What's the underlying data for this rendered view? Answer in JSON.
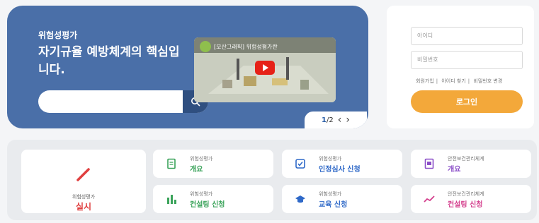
{
  "hero": {
    "subtitle": "위험성평가",
    "title": "자기규율 예방체계의 핵심입니다.",
    "search_placeholder": "",
    "video_title": "[모산그래픽] 위험성평가란",
    "pager": {
      "current": "1",
      "total": "/2",
      "prev": "‹",
      "next": "›"
    }
  },
  "login": {
    "id_placeholder": "아이디",
    "pw_placeholder": "비밀번호",
    "links": [
      "회원가입",
      "아이디 찾기",
      "비밀번호 변경"
    ],
    "button": "로그인"
  },
  "cards": {
    "main": {
      "line1": "위험성평가",
      "line2": "실시",
      "icon": "pencil-icon"
    },
    "items": [
      {
        "line1": "위험성평가",
        "line2": "개요",
        "icon": "document-icon",
        "color": "#3aa35a"
      },
      {
        "line1": "위험성평가",
        "line2": "인정심사 신청",
        "icon": "checklist-icon",
        "color": "#2f69c8"
      },
      {
        "line1": "안전보건관리체계",
        "line2": "개요",
        "icon": "document-list-icon",
        "color": "#8b4fc8"
      },
      {
        "line1": "위험성평가",
        "line2": "컨설팅 신청",
        "icon": "bar-chart-icon",
        "color": "#3aa35a"
      },
      {
        "line1": "위험성평가",
        "line2": "교육 신청",
        "icon": "graduation-cap-icon",
        "color": "#2f69c8"
      },
      {
        "line1": "안전보건관리체계",
        "line2": "컨설팅 신청",
        "icon": "trend-line-icon",
        "color": "#d43f8d"
      }
    ]
  }
}
